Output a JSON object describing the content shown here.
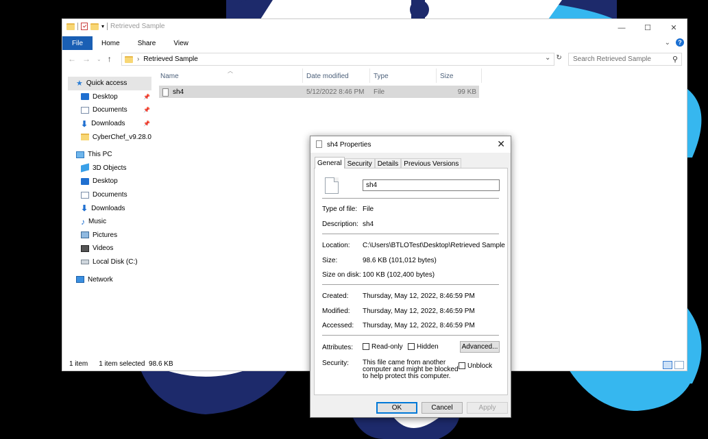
{
  "explorer": {
    "title": "Retrieved Sample",
    "window_controls": {
      "minimize": "—",
      "maximize": "☐",
      "close": "✕"
    },
    "ribbon_tabs": [
      "File",
      "Home",
      "Share",
      "View"
    ],
    "address": {
      "path": "Retrieved Sample"
    },
    "search": {
      "placeholder": "Search Retrieved Sample"
    },
    "sidebar": {
      "quick_access": "Quick access",
      "quick_items": [
        {
          "label": "Desktop",
          "icon": "desktop-icon",
          "pinned": true
        },
        {
          "label": "Documents",
          "icon": "documents-icon",
          "pinned": true
        },
        {
          "label": "Downloads",
          "icon": "downloads-icon",
          "pinned": true
        },
        {
          "label": "CyberChef_v9.28.0",
          "icon": "folder-icon",
          "pinned": false
        }
      ],
      "this_pc": "This PC",
      "pc_items": [
        {
          "label": "3D Objects",
          "icon": "3d-objects-icon"
        },
        {
          "label": "Desktop",
          "icon": "desktop-icon"
        },
        {
          "label": "Documents",
          "icon": "documents-icon"
        },
        {
          "label": "Downloads",
          "icon": "downloads-icon"
        },
        {
          "label": "Music",
          "icon": "music-icon"
        },
        {
          "label": "Pictures",
          "icon": "pictures-icon"
        },
        {
          "label": "Videos",
          "icon": "videos-icon"
        },
        {
          "label": "Local Disk (C:)",
          "icon": "local-disk-icon"
        }
      ],
      "network": "Network"
    },
    "columns": [
      "Name",
      "Date modified",
      "Type",
      "Size"
    ],
    "files": [
      {
        "name": "sh4",
        "date_modified": "5/12/2022 8:46 PM",
        "type": "File",
        "size": "99 KB"
      }
    ],
    "status": {
      "count": "1 item",
      "selected": "1 item selected  98.6 KB"
    }
  },
  "dialog": {
    "title": "sh4 Properties",
    "close": "✕",
    "tabs": [
      "General",
      "Security",
      "Details",
      "Previous Versions"
    ],
    "name_value": "sh4",
    "fields": [
      {
        "label": "Type of file:",
        "value": "File"
      },
      {
        "label": "Description:",
        "value": "sh4"
      },
      {
        "label": "Location:",
        "value": "C:\\Users\\BTLOTest\\Desktop\\Retrieved Sample"
      },
      {
        "label": "Size:",
        "value": "98.6 KB (101,012 bytes)"
      },
      {
        "label": "Size on disk:",
        "value": "100 KB (102,400 bytes)"
      },
      {
        "label": "Created:",
        "value": "Thursday, May 12, 2022, 8:46:59 PM"
      },
      {
        "label": "Modified:",
        "value": "Thursday, May 12, 2022, 8:46:59 PM"
      },
      {
        "label": "Accessed:",
        "value": "Thursday, May 12, 2022, 8:46:59 PM"
      }
    ],
    "attributes_label": "Attributes:",
    "readonly_label": "Read-only",
    "hidden_label": "Hidden",
    "advanced_label": "Advanced...",
    "security_label": "Security:",
    "security_text": "This file came from another computer and might be blocked to help protect this computer.",
    "unblock_label": "Unblock",
    "buttons": {
      "ok": "OK",
      "cancel": "Cancel",
      "apply": "Apply"
    }
  },
  "colors": {
    "accent": "#1a5fb4",
    "wallpaper_navy": "#1d2a6b",
    "wallpaper_cyan": "#36b7ef"
  }
}
